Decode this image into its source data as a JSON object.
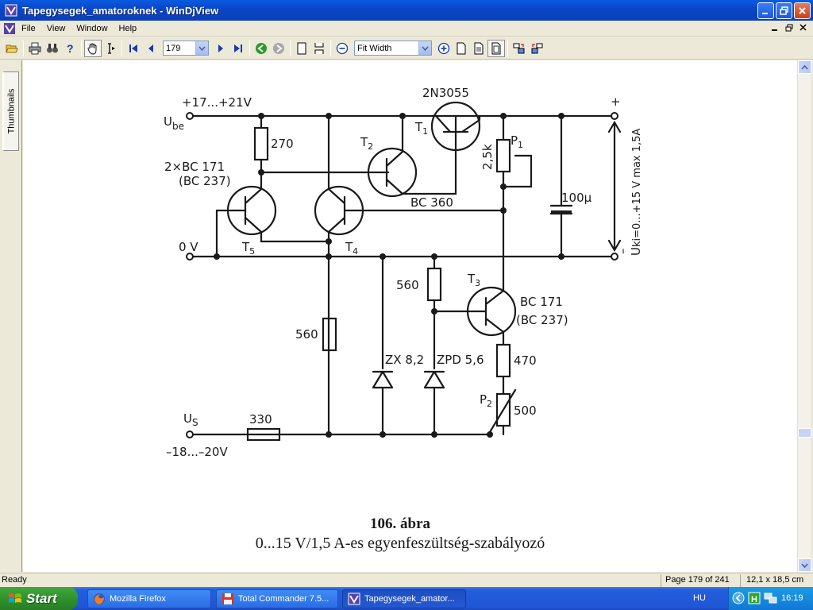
{
  "window": {
    "title": "Tapegysegek_amatoroknek - WinDjView"
  },
  "menu": {
    "items": [
      "File",
      "View",
      "Window",
      "Help"
    ]
  },
  "toolbar": {
    "page_value": "179",
    "zoom_value": "Fit Width"
  },
  "sidebar": {
    "tab_label": "Thumbnails"
  },
  "document": {
    "labels": {
      "ube_u": "U",
      "ube_sub": "be",
      "vin": "+17...+21V",
      "r270": "270",
      "bc171x2": "2×BC 171",
      "bc237a": "(BC 237)",
      "t2": "T",
      "t2sub": "2",
      "t1": "T",
      "t1sub": "1",
      "q2n3055": "2N3055",
      "bc360": "BC 360",
      "p1": "P",
      "p1sub": "1",
      "p1val": "2,5k",
      "c100": "100μ",
      "plus": "+",
      "minus": "–",
      "uki": "U",
      "uki_text": "ki=0...+15 V max 1,5A",
      "zero_v": "0 V",
      "t5": "T",
      "t5sub": "5",
      "t4": "T",
      "t4sub": "4",
      "r560a": "560",
      "t3": "T",
      "t3sub": "3",
      "bc171b": "BC 171",
      "bc237b": "(BC 237)",
      "r560b": "560",
      "zx": "ZX 8,2",
      "zpd": "ZPD 5,6",
      "r470": "470",
      "p2": "P",
      "p2sub": "2",
      "p2val": "500",
      "us_u": "U",
      "us_sub": "S",
      "r330": "330",
      "vneg": "–18...–20V"
    },
    "caption_line1": "106. ábra",
    "caption_line2": "0...15 V/1,5 A-es egyenfeszültség-szabályozó"
  },
  "status": {
    "ready": "Ready",
    "page_info": "Page 179 of 241",
    "dimensions": "12,1 x 18,5 cm"
  },
  "taskbar": {
    "start_label": "Start",
    "tasks": [
      {
        "label": "Mozilla Firefox"
      },
      {
        "label": "Total Commander 7.5..."
      },
      {
        "label": "Tapegysegek_amator..."
      }
    ],
    "lang": "HU",
    "clock": "16:19"
  }
}
